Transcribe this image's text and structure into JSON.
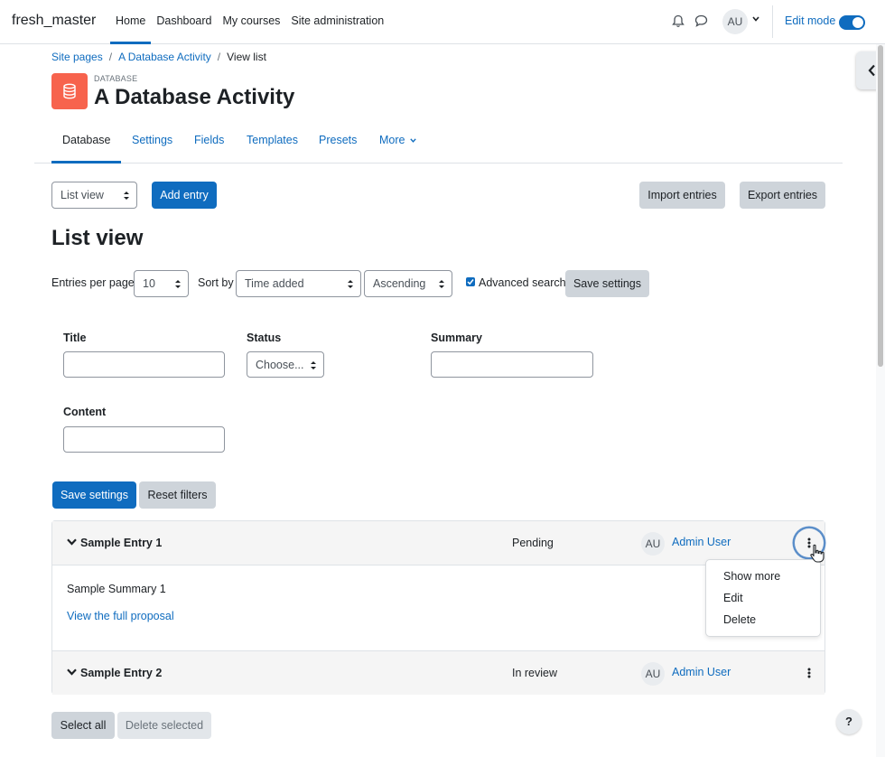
{
  "navbar": {
    "brand": "fresh_master",
    "items": [
      {
        "label": "Home",
        "active": true
      },
      {
        "label": "Dashboard",
        "active": false
      },
      {
        "label": "My courses",
        "active": false
      },
      {
        "label": "Site administration",
        "active": false
      }
    ],
    "avatar_initials": "AU",
    "edit_mode_label": "Edit mode",
    "edit_mode_on": true
  },
  "breadcrumb": [
    "Site pages",
    "A Database Activity",
    "View list"
  ],
  "header": {
    "module_label": "DATABASE",
    "title": "A Database Activity",
    "icon": "database-icon",
    "icon_color": "#f7634d"
  },
  "secondary_nav": {
    "items": [
      "Database",
      "Settings",
      "Fields",
      "Templates",
      "Presets",
      "More"
    ],
    "active": "Database"
  },
  "action_bar": {
    "view_select": "List view",
    "add_entry": "Add entry",
    "import": "Import entries",
    "export": "Export entries"
  },
  "list_heading": "List view",
  "options": {
    "entries_label": "Entries per page",
    "entries_value": "10",
    "sort_label": "Sort by",
    "sort_value": "Time added",
    "order_value": "Ascending",
    "advanced_label": "Advanced search",
    "advanced_checked": true,
    "save_settings": "Save settings"
  },
  "search": {
    "title_label": "Title",
    "status_label": "Status",
    "status_value": "Choose...",
    "summary_label": "Summary",
    "content_label": "Content",
    "save_settings": "Save settings",
    "reset_filters": "Reset filters"
  },
  "entries": [
    {
      "title": "Sample Entry 1",
      "status": "Pending",
      "avatar": "AU",
      "user": "Admin User",
      "summary": "Sample Summary 1",
      "link": "View the full proposal",
      "expanded": true
    },
    {
      "title": "Sample Entry 2",
      "status": "In review",
      "avatar": "AU",
      "user": "Admin User",
      "expanded": false
    }
  ],
  "menu": [
    "Show more",
    "Edit",
    "Delete"
  ],
  "footer": {
    "select_all": "Select all",
    "delete_selected": "Delete selected",
    "help": "?"
  },
  "colors": {
    "primary": "#0f6cbf",
    "secondary_button": "#ced4da",
    "accent_icon": "#f7634d"
  }
}
